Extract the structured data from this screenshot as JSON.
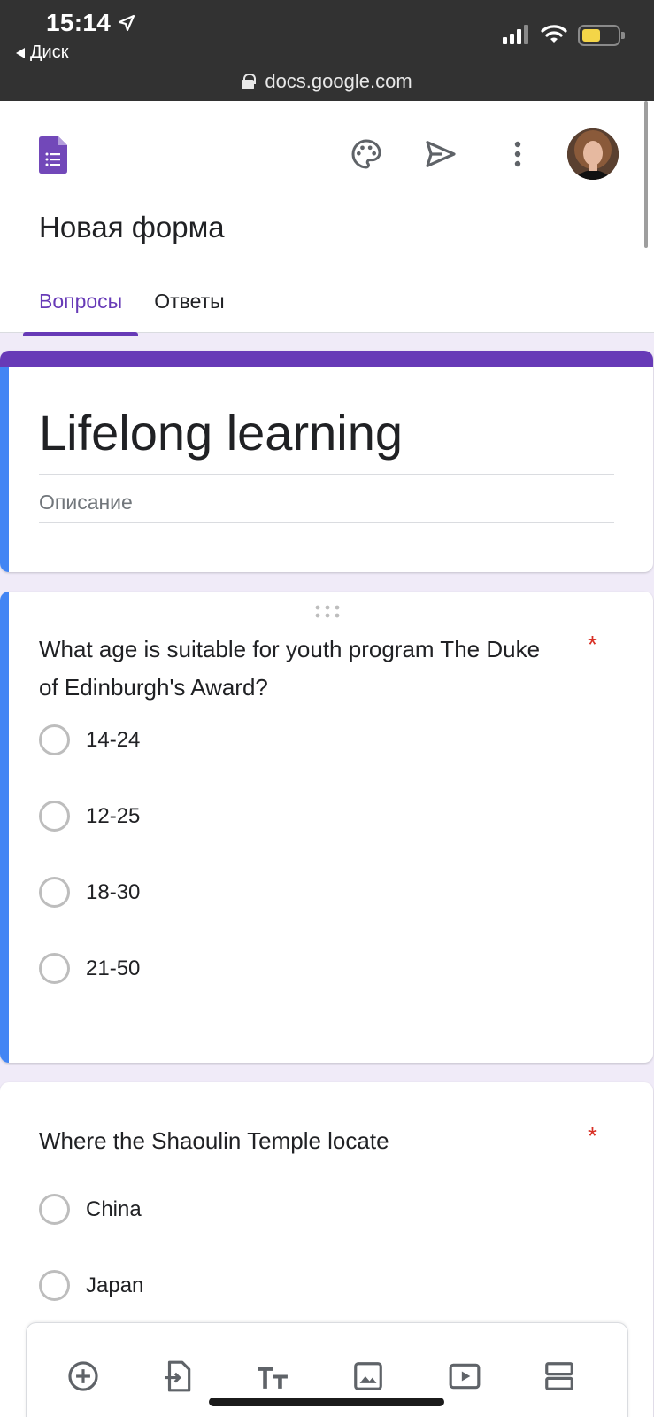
{
  "status_bar": {
    "time": "15:14",
    "back_label": "Диск",
    "url": "docs.google.com"
  },
  "header": {
    "form_name": "Новая форма",
    "tabs": [
      {
        "label": "Вопросы",
        "active": true
      },
      {
        "label": "Ответы",
        "active": false
      }
    ],
    "icons": [
      "forms-logo-icon",
      "palette-icon",
      "send-icon",
      "more-vert-icon",
      "avatar"
    ]
  },
  "title_card": {
    "title": "Lifelong learning",
    "description_placeholder": "Описание"
  },
  "questions": [
    {
      "text": "What age is suitable for youth program The Duke of Edinburgh's Award?",
      "required_mark": "*",
      "options": [
        "14-24",
        "12-25",
        "18-30",
        "21-50"
      ]
    },
    {
      "text": "Where the Shaoulin Temple locate",
      "required_mark": "*",
      "options": [
        "China",
        "Japan"
      ]
    }
  ],
  "toolbar": {
    "icons": [
      "add-question-icon",
      "import-questions-icon",
      "add-title-icon",
      "add-image-icon",
      "add-video-icon",
      "add-section-icon"
    ]
  },
  "colors": {
    "accent": "#673ab7",
    "focus_bar": "#4285f4",
    "required": "#d93025",
    "background": "#f0ebf8"
  }
}
